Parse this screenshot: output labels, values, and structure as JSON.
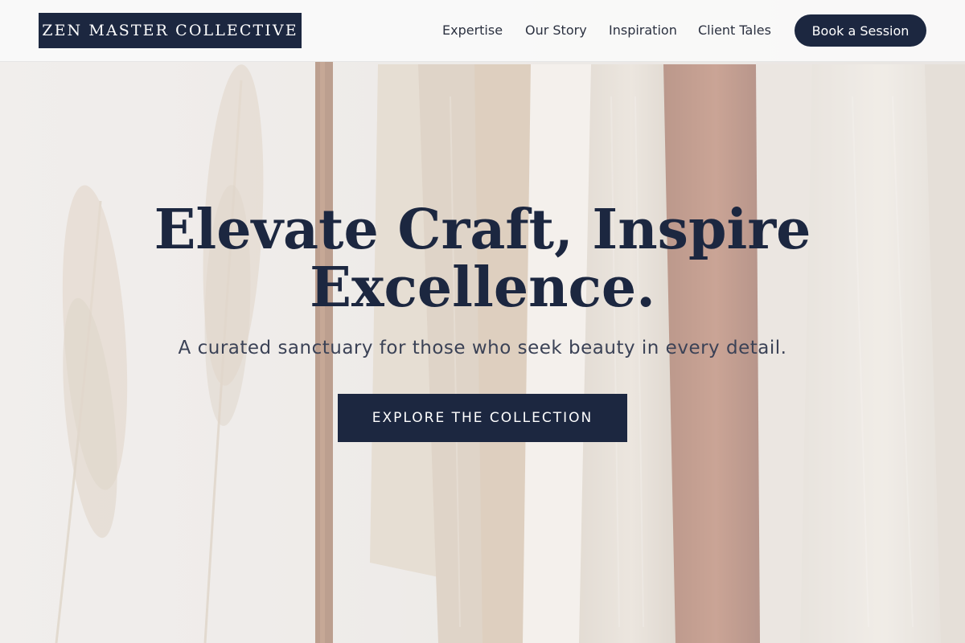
{
  "header": {
    "brand": "ZEN MASTER COLLECTIVE",
    "nav": [
      {
        "label": "Expertise"
      },
      {
        "label": "Our Story"
      },
      {
        "label": "Inspiration"
      },
      {
        "label": "Client Tales"
      }
    ],
    "cta_label": "Book a Session"
  },
  "hero": {
    "headline_line1": "Elevate Craft, Inspire",
    "headline_line2": "Excellence.",
    "subheadline": "A curated sanctuary for those who seek beauty in every detail.",
    "cta_label": "EXPLORE THE COLLECTION"
  },
  "colors": {
    "primary": "#1c2740",
    "nav_text": "#2b3140",
    "subtext": "#3b4256",
    "header_bg": "#fafafa"
  }
}
